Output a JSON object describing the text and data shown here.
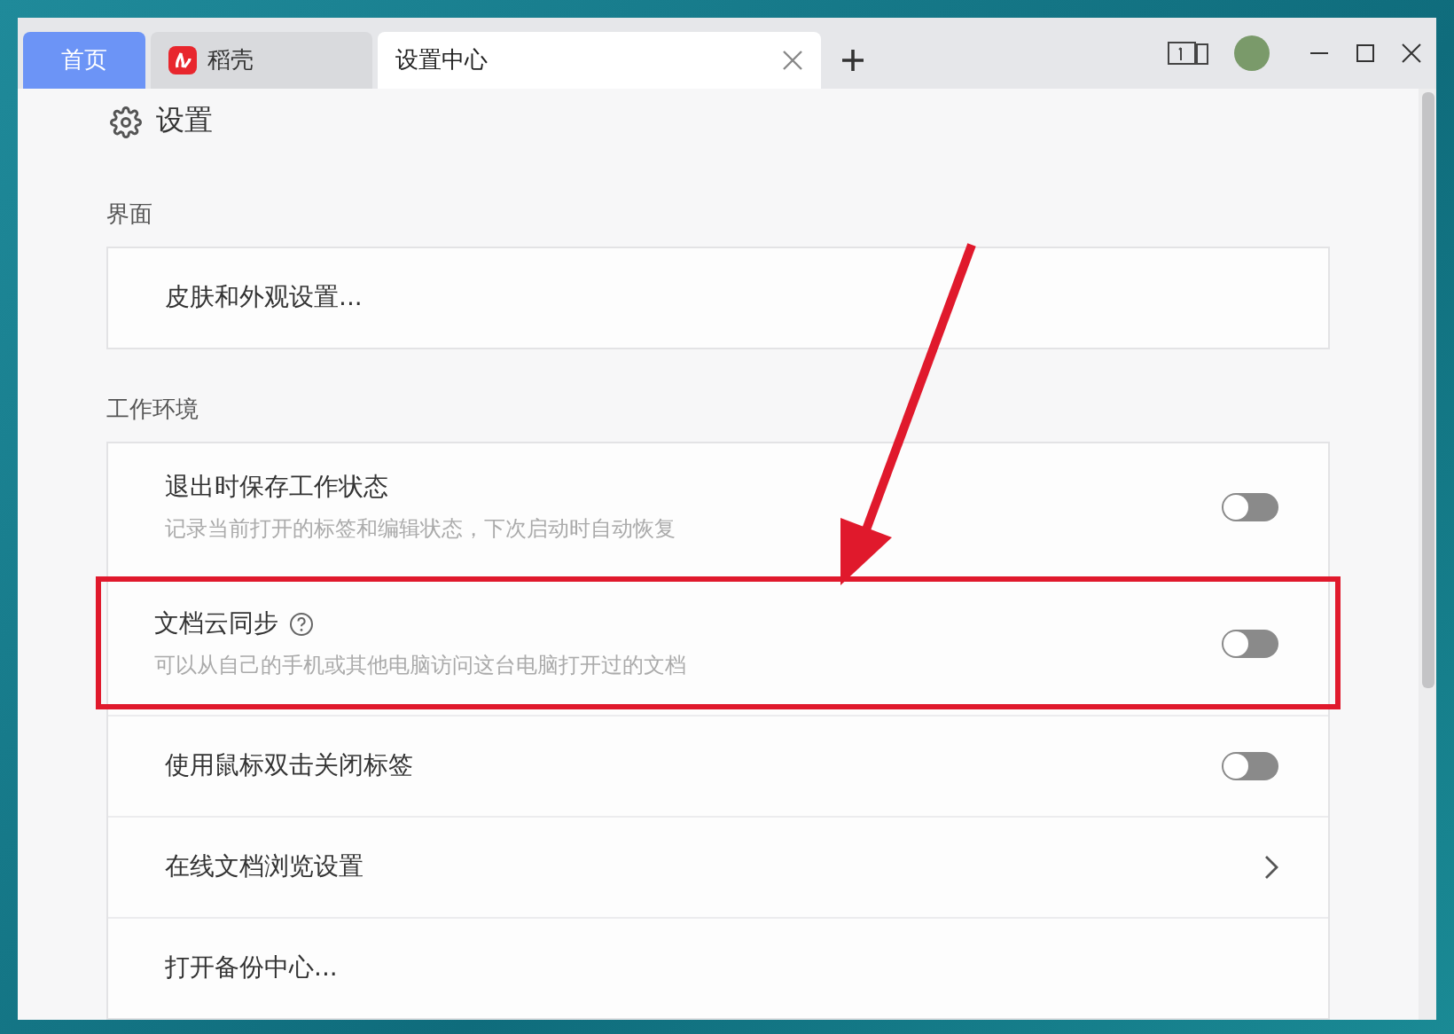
{
  "tabs": [
    {
      "label": "首页",
      "kind": "home",
      "selected": false
    },
    {
      "label": "稻壳",
      "kind": "docer",
      "selected": false
    },
    {
      "label": "设置中心",
      "kind": "page",
      "selected": true
    }
  ],
  "page_title": "设置",
  "sections": [
    {
      "title": "界面",
      "items": [
        {
          "kind": "plain",
          "label": "皮肤和外观设置..."
        }
      ]
    },
    {
      "title": "工作环境",
      "items": [
        {
          "kind": "toggle",
          "label": "退出时保存工作状态",
          "description": "记录当前打开的标签和编辑状态，下次启动时自动恢复",
          "on": false,
          "help": false,
          "highlighted": false
        },
        {
          "kind": "toggle",
          "label": "文档云同步",
          "description": "可以从自己的手机或其他电脑访问这台电脑打开过的文档",
          "on": false,
          "help": true,
          "highlighted": true
        },
        {
          "kind": "toggle",
          "label": "使用鼠标双击关闭标签",
          "on": false,
          "help": false,
          "highlighted": false
        },
        {
          "kind": "nav",
          "label": "在线文档浏览设置"
        },
        {
          "kind": "plain",
          "label": "打开备份中心..."
        }
      ]
    }
  ]
}
